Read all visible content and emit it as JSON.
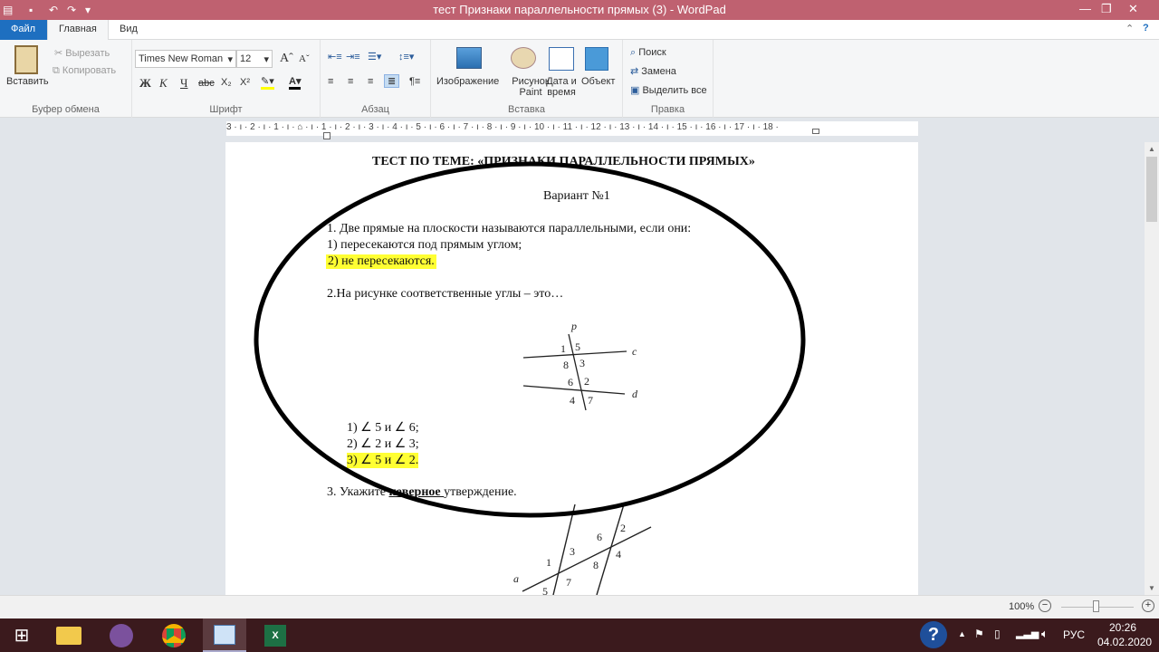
{
  "window": {
    "title": "тест  Признаки параллельности прямых (3) - WordPad"
  },
  "tabs": [
    "Файл",
    "Главная",
    "Вид"
  ],
  "clipboard": {
    "paste": "Вставить",
    "cut": "Вырезать",
    "copy": "Копировать",
    "label": "Буфер обмена"
  },
  "font": {
    "family": "Times New Roman",
    "size": "12",
    "label": "Шрифт",
    "bold": "Ж",
    "italic": "К",
    "underline": "Ч",
    "strike": "abc",
    "sub": "X₂",
    "sup": "X²"
  },
  "paragraph": {
    "label": "Абзац"
  },
  "insert": {
    "image": "Изображение",
    "paint": "Рисунок Paint",
    "datetime": "Дата и время",
    "object": "Объект",
    "label": "Вставка"
  },
  "editing": {
    "find": "Поиск",
    "replace": "Замена",
    "select_all": "Выделить все",
    "label": "Правка"
  },
  "ruler": "3 · ı · 2 · ı · 1 · ı · ⌂ · ı · 1 · ı · 2 · ı · 3 · ı · 4 · ı · 5 · ı · 6 · ı · 7 · ı · 8 · ı · 9 · ı · 10 · ı · 11 · ı · 12 · ı · 13 · ı · 14 · ı · 15 · ı · 16 · ı · 17 · ı · 18 ·",
  "document": {
    "title": "ТЕСТ  ПО ТЕМЕ: «ПРИЗНАКИ ПАРАЛЛЕЛЬНОСТИ  ПРЯМЫХ»",
    "variant": "Вариант №1",
    "q1": "1. Две прямые на плоскости называются параллельными, если они:",
    "q1_a1": "1) пересекаются под прямым углом;",
    "q1_a2": "2) не пересекаются.",
    "q2": "2.На рисунке соответственные углы – это…",
    "fig1": {
      "p": "p",
      "c": "c",
      "d": "d",
      "n1": "1",
      "n5": "5",
      "n8": "8",
      "n3": "3",
      "n6": "6",
      "n2": "2",
      "n4": "4",
      "n7": "7"
    },
    "q2_a1": "1) ∠ 5 и ∠  6;",
    "q2_a2": "2) ∠ 2 и  ∠ 3;",
    "q2_a3": "3) ∠  5 и ∠  2.",
    "q3_pre": "3. Укажите ",
    "q3_bold": "неверное ",
    "q3_post": "утверждение.",
    "fig2": {
      "a": "a",
      "n1": "1",
      "n3": "3",
      "n6": "6",
      "n2": "2",
      "n4": "4",
      "n8": "8",
      "n7": "7",
      "n5": "5"
    }
  },
  "status": {
    "zoom": "100%"
  },
  "tray": {
    "lang": "РУС",
    "time": "20:26",
    "date": "04.02.2020"
  }
}
